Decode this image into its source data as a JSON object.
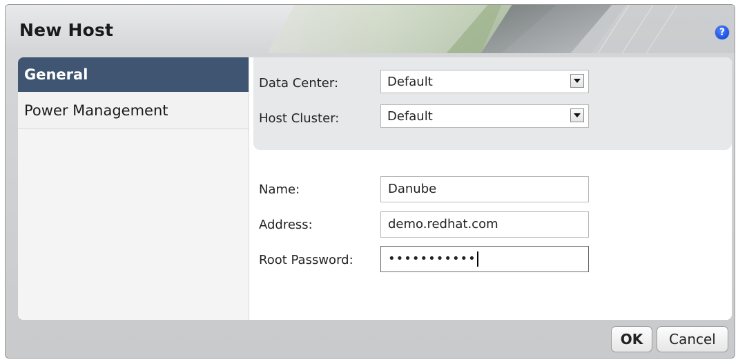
{
  "dialog": {
    "title": "New Host",
    "help_icon": "help-icon",
    "help_glyph": "?"
  },
  "sidebar": {
    "tabs": [
      {
        "label": "General",
        "active": true
      },
      {
        "label": "Power Management",
        "active": false
      }
    ]
  },
  "form": {
    "data_center": {
      "label": "Data Center:",
      "value": "Default"
    },
    "host_cluster": {
      "label": "Host Cluster:",
      "value": "Default"
    },
    "name": {
      "label": "Name:",
      "value": "Danube"
    },
    "address": {
      "label": "Address:",
      "value": "demo.redhat.com"
    },
    "root_password": {
      "label": "Root Password:",
      "masked_value": "•••••••••••"
    }
  },
  "buttons": {
    "ok": "OK",
    "cancel": "Cancel"
  },
  "colors": {
    "active_tab_bg": "#3f5572",
    "panel_bg": "#e7e8ea",
    "help_icon_blue": "#1d4fe0"
  }
}
